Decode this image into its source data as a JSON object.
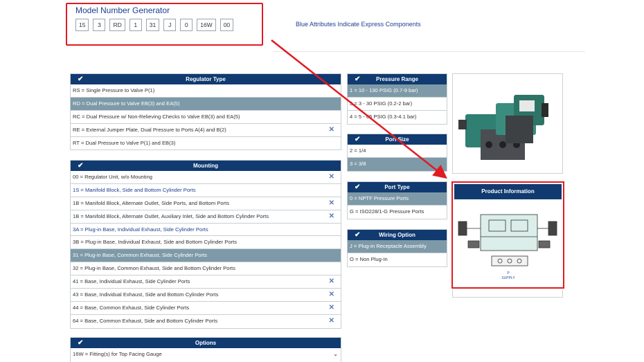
{
  "generator": {
    "title": "Model Number Generator",
    "boxes": [
      "15",
      "3",
      "RD",
      "1",
      "31",
      "J",
      "0",
      "16W",
      "00"
    ]
  },
  "note": "Blue Attributes Indicate Express Components",
  "regulator_type": {
    "title": "Regulator Type",
    "rows": [
      "RS = Single Pressure to Valve P(1)",
      "RD = Dual Pressure to Valve EB(3) and EA(5)",
      "RC = Dual Pressure w/ Non-Relieving Checks to Valve EB(3) and EA(5)",
      "RE = External Jumper Plate, Dual Pressure to Ports A(4) and B(2)",
      "RT = Dual Pressure to Valve P(1) and EB(3)"
    ]
  },
  "mounting": {
    "title": "Mounting",
    "rows": [
      "00 = Regulator Unit, w/o Mounting",
      "1S = Manifold Block, Side and Bottom Cylinder Ports",
      "1B = Manifold Block, Alternate Outlet, Side Ports, and Bottom Ports",
      "1B = Manifold Block, Alternate Outlet, Auxiliary Inlet, Side and Bottom Cylinder Ports",
      "3A = Plug-in Base, Individual Exhaust, Side Cylinder Ports",
      "3B = Plug-in Base, Individual Exhaust, Side and Bottom Cylinder Ports",
      "31 = Plug-in Base, Common Exhaust, Side Cylinder Ports",
      "32 = Plug-in Base, Common Exhaust, Side and Bottom Cylinder Ports",
      "41 = Base, Individual Exhaust, Side Cylinder Ports",
      "43 = Base, Individual Exhaust, Side and Bottom Cylinder Ports",
      "44 = Base, Common Exhaust, Side Cylinder Ports",
      "64 = Base, Common Exhaust, Side and Bottom Cylinder Ports"
    ]
  },
  "options": {
    "title": "Options",
    "selected": "16W = Fitting(s) for Top Facing Gauge"
  },
  "pressure_range": {
    "title": "Pressure Range",
    "rows": [
      "1 = 10 - 130 PSIG (0.7-9 bar)",
      "3 = 3 - 30 PSIG (0.2-2 bar)",
      "4 = 5 - 65 PSIG (0.3-4.1 bar)"
    ]
  },
  "port_size": {
    "title": "Port Size",
    "rows": [
      "2 = 1/4",
      "3 = 3/8"
    ]
  },
  "port_type": {
    "title": "Port Type",
    "rows": [
      "0 = NPTF Pressure Ports",
      "G = ISO228/1-G Pressure Ports"
    ]
  },
  "wiring_option": {
    "title": "Wiring Option",
    "rows": [
      "J = Plug-in Receptacle Assembly",
      "O = Non Plug-In"
    ]
  },
  "product_info": {
    "title": "Product Information",
    "drawing_label_1": "P",
    "drawing_label_2": "SUPPLY"
  },
  "colors": {
    "header_navy": "#103a70",
    "selected_row": "#7e9aa8",
    "express_blue": "#1c3f8f",
    "highlight_red": "#e01b24",
    "remove_x": "#5a79b3"
  },
  "icons": {
    "panel_check": "✔",
    "remove": "✕",
    "dropdown": "⌄"
  }
}
